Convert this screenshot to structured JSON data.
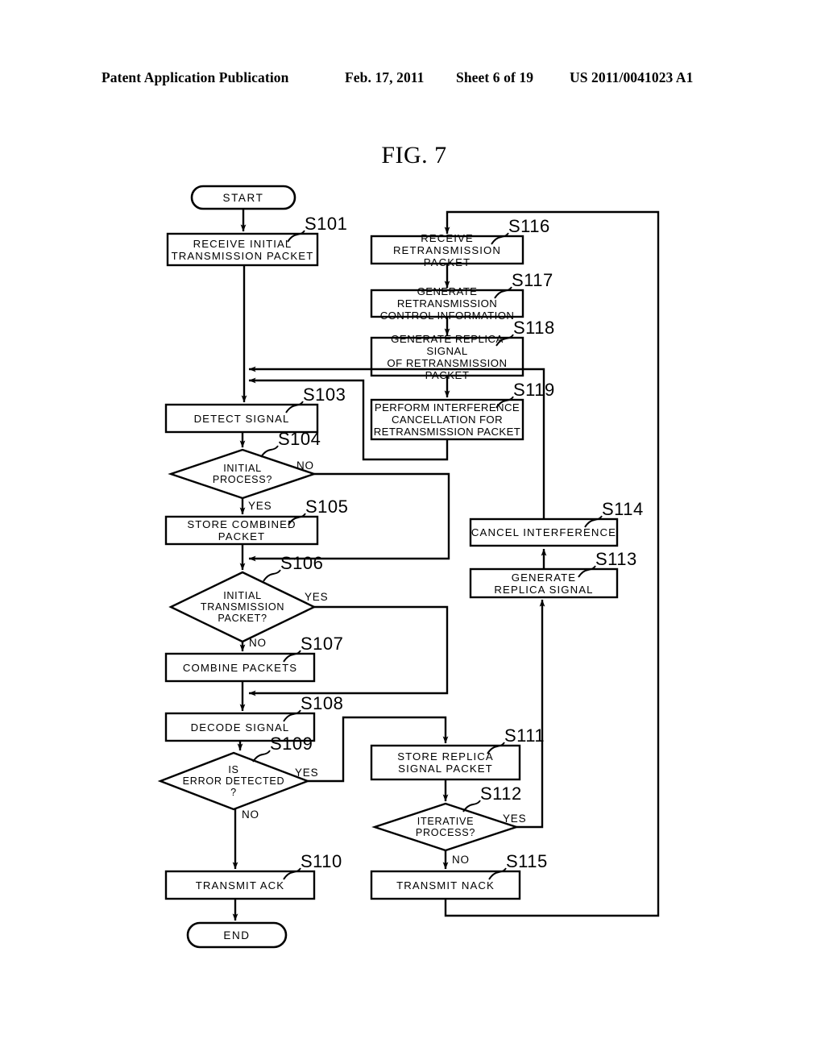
{
  "header": {
    "publication": "Patent Application Publication",
    "date": "Feb. 17, 2011",
    "sheet": "Sheet 6 of 19",
    "patent_number": "US 2011/0041023 A1"
  },
  "figure": {
    "title": "FIG. 7"
  },
  "nodes": {
    "start": {
      "tag": "",
      "text": "START"
    },
    "s101": {
      "tag": "S101",
      "text": "RECEIVE  INITIAL\nTRANSMISSION  PACKET"
    },
    "s103": {
      "tag": "S103",
      "text": "DETECT  SIGNAL"
    },
    "s104": {
      "tag": "S104",
      "text": "INITIAL\nPROCESS?"
    },
    "s105": {
      "tag": "S105",
      "text": "STORE  COMBINED  PACKET"
    },
    "s106": {
      "tag": "S106",
      "text": "INITIAL\nTRANSMISSION\nPACKET?"
    },
    "s107": {
      "tag": "S107",
      "text": "COMBINE  PACKETS"
    },
    "s108": {
      "tag": "S108",
      "text": "DECODE  SIGNAL"
    },
    "s109": {
      "tag": "S109",
      "text": "IS\nERROR  DETECTED\n?"
    },
    "s110": {
      "tag": "S110",
      "text": "TRANSMIT  ACK"
    },
    "end": {
      "tag": "",
      "text": "END"
    },
    "s111": {
      "tag": "S111",
      "text": "STORE  REPLICA\nSIGNAL  PACKET"
    },
    "s112": {
      "tag": "S112",
      "text": "ITERATIVE\nPROCESS?"
    },
    "s113": {
      "tag": "S113",
      "text": "GENERATE\nREPLICA  SIGNAL"
    },
    "s114": {
      "tag": "S114",
      "text": "CANCEL  INTERFERENCE"
    },
    "s115": {
      "tag": "S115",
      "text": "TRANSMIT  NACK"
    },
    "s116": {
      "tag": "S116",
      "text": "RECEIVE\nRETRANSMISSION  PACKET"
    },
    "s117": {
      "tag": "S117",
      "text": "GENERATE  RETRANSMISSION\nCONTROL  INFORMATION"
    },
    "s118": {
      "tag": "S118",
      "text": "GENERATE  REPLICA  SIGNAL\nOF  RETRANSMISSION\nPACKET"
    },
    "s119": {
      "tag": "S119",
      "text": "PERFORM  INTERFERENCE\nCANCELLATION  FOR\nRETRANSMISSION  PACKET"
    }
  },
  "branches": {
    "s104_no": "NO",
    "s104_yes": "YES",
    "s106_yes": "YES",
    "s106_no": "NO",
    "s109_yes": "YES",
    "s109_no": "NO",
    "s112_yes": "YES",
    "s112_no": "NO"
  },
  "style": {
    "line_color": "#000000",
    "background": "#ffffff"
  }
}
